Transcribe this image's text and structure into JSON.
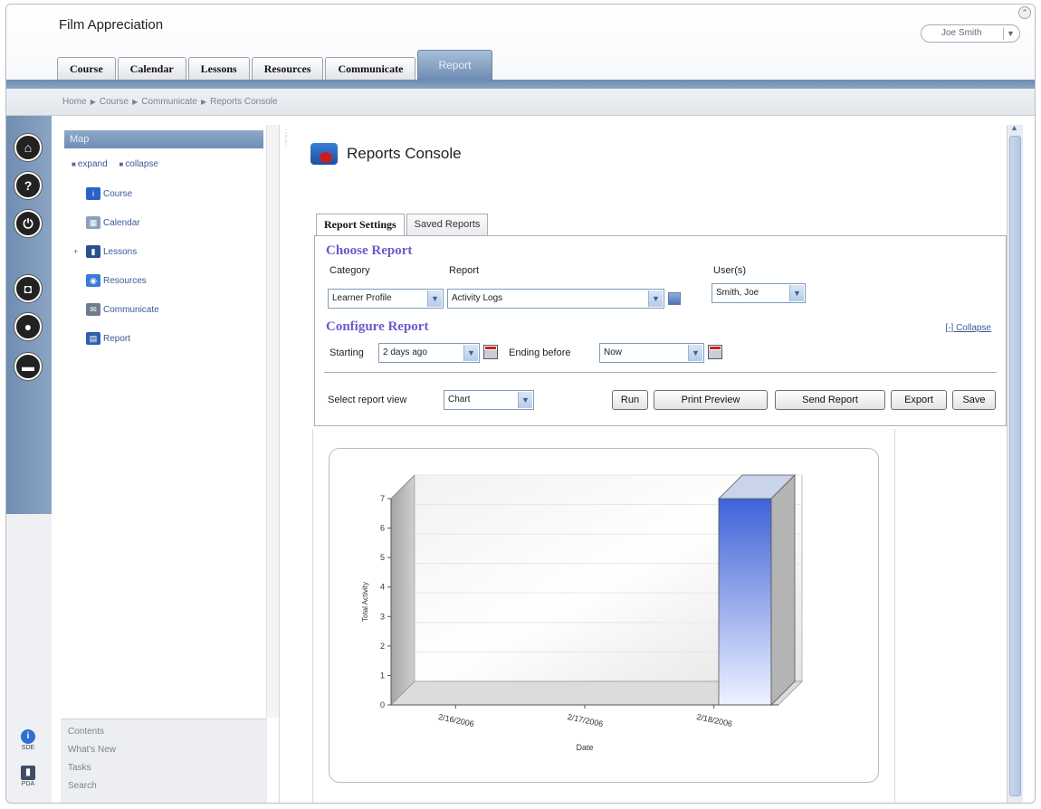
{
  "app": {
    "title": "Film Appreciation",
    "corner_glyph": "⌃"
  },
  "top_tabs": [
    {
      "label": "Course",
      "active": false
    },
    {
      "label": "Calendar",
      "active": false
    },
    {
      "label": "Lessons",
      "active": false
    },
    {
      "label": "Resources",
      "active": false
    },
    {
      "label": "Communicate",
      "active": false
    },
    {
      "label": "Report",
      "active": true
    }
  ],
  "breadcrumb": [
    "Home",
    "Course",
    "Communicate",
    "Reports Console"
  ],
  "breadcrumb_sep": "▶",
  "user_menu": {
    "label": "Joe Smith",
    "arrow": "▼"
  },
  "rail": {
    "buttons": [
      {
        "icon": "home-icon",
        "glyph": "⌂"
      },
      {
        "icon": "help-icon",
        "glyph": "?"
      },
      {
        "icon": "power-icon",
        "glyph": "⏻"
      },
      {
        "icon": "camera-icon",
        "glyph": "◘"
      },
      {
        "icon": "person-icon",
        "glyph": "●"
      },
      {
        "icon": "chat-icon",
        "glyph": "▬"
      }
    ],
    "bottom": [
      {
        "icon": "info-icon",
        "glyph": "i",
        "label": "SDE"
      },
      {
        "icon": "pda-icon",
        "glyph": "▮",
        "label": "PDA"
      }
    ]
  },
  "nav": {
    "header": "Map",
    "expand": "expand",
    "collapse": "collapse",
    "items": [
      {
        "label": "Course",
        "icon": "info-icon",
        "color": "#2a62c9",
        "glyph": "i",
        "expander": ""
      },
      {
        "label": "Calendar",
        "icon": "calendar-icon",
        "color": "#8aa0bd",
        "glyph": "▦",
        "expander": ""
      },
      {
        "label": "Lessons",
        "icon": "book-icon",
        "color": "#2c4f8f",
        "glyph": "▮",
        "expander": "+"
      },
      {
        "label": "Resources",
        "icon": "globe-icon",
        "color": "#3a7bd5",
        "glyph": "◉",
        "expander": ""
      },
      {
        "label": "Communicate",
        "icon": "communicate-icon",
        "color": "#6f7c8f",
        "glyph": "✉",
        "expander": ""
      },
      {
        "label": "Report",
        "icon": "report-icon",
        "color": "#2f5fb0",
        "glyph": "▤",
        "expander": ""
      }
    ],
    "footer": [
      "Contents",
      "What's New",
      "Tasks",
      "Search"
    ]
  },
  "console": {
    "title": "Reports Console"
  },
  "report_tabs": [
    {
      "label": "Report Settings",
      "active": true
    },
    {
      "label": "Saved Reports",
      "active": false
    }
  ],
  "choose_report": {
    "title": "Choose Report",
    "category_label": "Category",
    "category_value": "Learner Profile",
    "report_label": "Report",
    "report_value": "Activity Logs",
    "users_label": "User(s)",
    "users_value": "Smith, Joe"
  },
  "configure_report": {
    "title": "Configure Report",
    "collapse_link": "[-] Collapse",
    "starting_label": "Starting",
    "starting_value": "2 days ago",
    "ending_label": "Ending before",
    "ending_value": "Now"
  },
  "view": {
    "label": "Select report view",
    "value": "Chart",
    "buttons": [
      "Run",
      "Print Preview",
      "Send Report",
      "Export",
      "Save"
    ]
  },
  "dropdown_arrow": "▼",
  "chart_data": {
    "type": "bar",
    "categories": [
      "2/16/2006",
      "2/17/2006",
      "2/18/2006"
    ],
    "values": [
      0,
      0,
      7
    ],
    "ylabel": "Total Activity",
    "xlabel": "Date",
    "ylim": [
      0,
      7
    ],
    "yticks": [
      0,
      1,
      2,
      3,
      4,
      5,
      6,
      7
    ],
    "grid": true,
    "style": "3d",
    "bar_color": "#3f63d8"
  }
}
